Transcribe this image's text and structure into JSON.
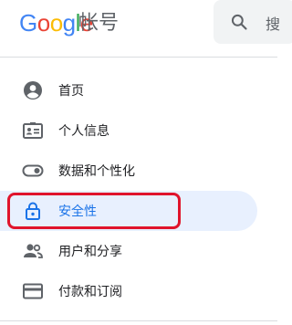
{
  "header": {
    "logo_text": "Google",
    "product_name": "帐号",
    "search": {
      "placeholder": "搜"
    }
  },
  "sidebar": {
    "items": [
      {
        "label": "首页",
        "icon": "account-circle-icon"
      },
      {
        "label": "个人信息",
        "icon": "badge-icon"
      },
      {
        "label": "数据和个性化",
        "icon": "toggle-icon"
      },
      {
        "label": "安全性",
        "icon": "lock-icon",
        "active": true
      },
      {
        "label": "用户和分享",
        "icon": "people-icon"
      },
      {
        "label": "付款和订阅",
        "icon": "credit-card-icon"
      }
    ]
  },
  "colors": {
    "active_bg": "#e8f0fe",
    "active_text": "#1a73e8",
    "highlight_border": "#e0142c"
  }
}
